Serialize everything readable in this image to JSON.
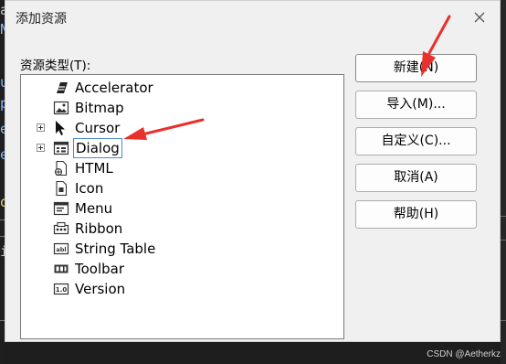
{
  "window": {
    "title": "添加资源"
  },
  "resource_type_label": "资源类型(T):",
  "resource_types": [
    {
      "label": "Accelerator",
      "icon": "accelerator-icon",
      "expandable": false,
      "selected": false
    },
    {
      "label": "Bitmap",
      "icon": "bitmap-icon",
      "expandable": false,
      "selected": false
    },
    {
      "label": "Cursor",
      "icon": "cursor-icon",
      "expandable": true,
      "selected": false
    },
    {
      "label": "Dialog",
      "icon": "dialog-icon",
      "expandable": true,
      "selected": true
    },
    {
      "label": "HTML",
      "icon": "html-icon",
      "expandable": false,
      "selected": false
    },
    {
      "label": "Icon",
      "icon": "icon-resource-icon",
      "expandable": false,
      "selected": false
    },
    {
      "label": "Menu",
      "icon": "menu-icon",
      "expandable": false,
      "selected": false
    },
    {
      "label": "Ribbon",
      "icon": "ribbon-icon",
      "expandable": false,
      "selected": false
    },
    {
      "label": "String Table",
      "icon": "string-table-icon",
      "expandable": false,
      "selected": false
    },
    {
      "label": "Toolbar",
      "icon": "toolbar-icon",
      "expandable": false,
      "selected": false
    },
    {
      "label": "Version",
      "icon": "version-icon",
      "expandable": false,
      "selected": false
    }
  ],
  "buttons": {
    "new": "新建(N)",
    "import": "导入(M)...",
    "custom": "自定义(C)...",
    "cancel": "取消(A)",
    "help": "帮助(H)"
  },
  "background_text": [
    "a",
    "N",
    "u",
    "p",
    "e",
    "e",
    "o",
    "i"
  ],
  "watermark": "CSDN @Aetherkz",
  "colors": {
    "annotation_arrow": "#e8302c",
    "selection_border": "#4a8cc9",
    "dialog_bg": "#f0f0f0"
  }
}
